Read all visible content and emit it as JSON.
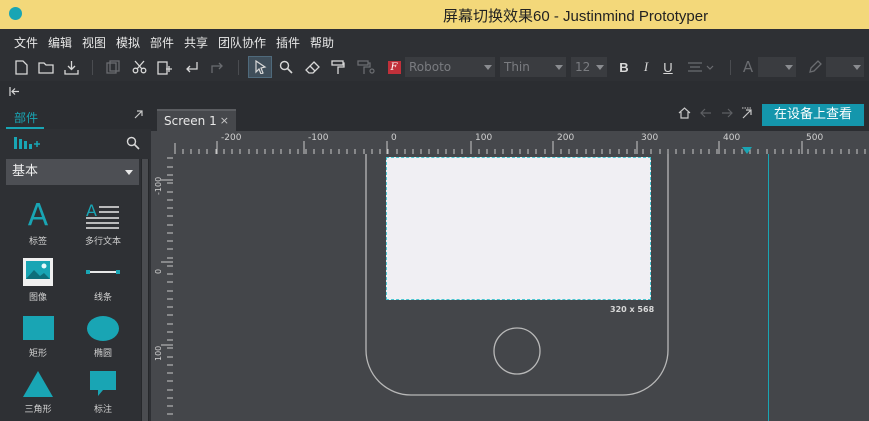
{
  "window": {
    "title": "屏幕切换效果60 - Justinmind Prototyper"
  },
  "menu": [
    "文件",
    "编辑",
    "视图",
    "模拟",
    "部件",
    "共享",
    "团队协作",
    "插件",
    "帮助"
  ],
  "toolbar": {
    "font_family": "Roboto",
    "font_weight": "Thin",
    "font_size": "12",
    "bold": "B",
    "italic": "I",
    "underline": "U",
    "text_color_glyph": "A"
  },
  "left_panel": {
    "tab": "部件",
    "category": "基本",
    "widgets": [
      {
        "label": "标签",
        "icon": "text-label-icon"
      },
      {
        "label": "多行文本",
        "icon": "multiline-text-icon"
      },
      {
        "label": "图像",
        "icon": "image-icon"
      },
      {
        "label": "线条",
        "icon": "line-icon"
      },
      {
        "label": "矩形",
        "icon": "rectangle-icon"
      },
      {
        "label": "椭圆",
        "icon": "ellipse-icon"
      },
      {
        "label": "三角形",
        "icon": "triangle-icon"
      },
      {
        "label": "标注",
        "icon": "callout-icon"
      }
    ]
  },
  "canvas": {
    "tab_label": "Screen 1",
    "preview_button": "在设备上查看",
    "screen_size_label": "320 x 568",
    "ruler_h_labels": [
      "-200",
      "-100",
      "0",
      "100",
      "200",
      "300",
      "400",
      "500"
    ],
    "ruler_v_labels": [
      "-100",
      "0",
      "100"
    ]
  },
  "colors": {
    "accent": "#19a5b4",
    "titlebar": "#f3d87a",
    "canvas_bg": "#46484c",
    "panel_bg": "#2e3034"
  }
}
